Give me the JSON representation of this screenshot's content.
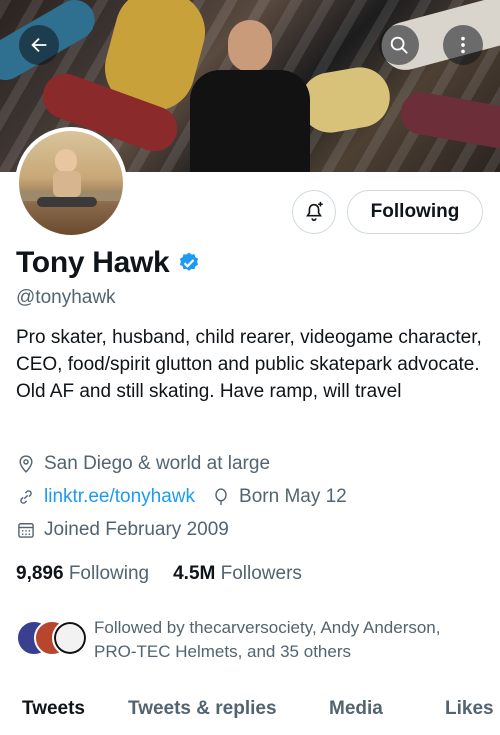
{
  "header": {
    "back_icon": "arrow-left-icon",
    "search_icon": "search-icon",
    "more_icon": "more-vertical-icon"
  },
  "profile": {
    "name": "Tony Hawk",
    "verified_icon": "verified-badge-icon",
    "handle": "@tonyhawk",
    "bio": "Pro skater, husband, child rearer, videogame character, CEO, food/spirit glutton and public skatepark advocate. Old AF and still skating. Have ramp, will travel",
    "location": "San Diego & world at large",
    "website": "linktr.ee/tonyhawk",
    "birthday": "Born May 12",
    "joined": "Joined February 2009"
  },
  "actions": {
    "notify_icon": "bell-plus-icon",
    "following_label": "Following"
  },
  "stats": {
    "following_count": "9,896",
    "following_label": "Following",
    "followers_count": "4.5M",
    "followers_label": "Followers"
  },
  "followed_by": {
    "text": "Followed by thecarversociety, Andy Anderson, PRO-TEC Helmets, and 35 others"
  },
  "tabs": [
    {
      "label": "Tweets",
      "active": true
    },
    {
      "label": "Tweets & replies",
      "active": false
    },
    {
      "label": "Media",
      "active": false
    },
    {
      "label": "Likes",
      "active": false
    }
  ],
  "colors": {
    "accent": "#1d9bf0",
    "text_primary": "#0f1419",
    "text_secondary": "#536471",
    "border": "#cfd9de"
  }
}
